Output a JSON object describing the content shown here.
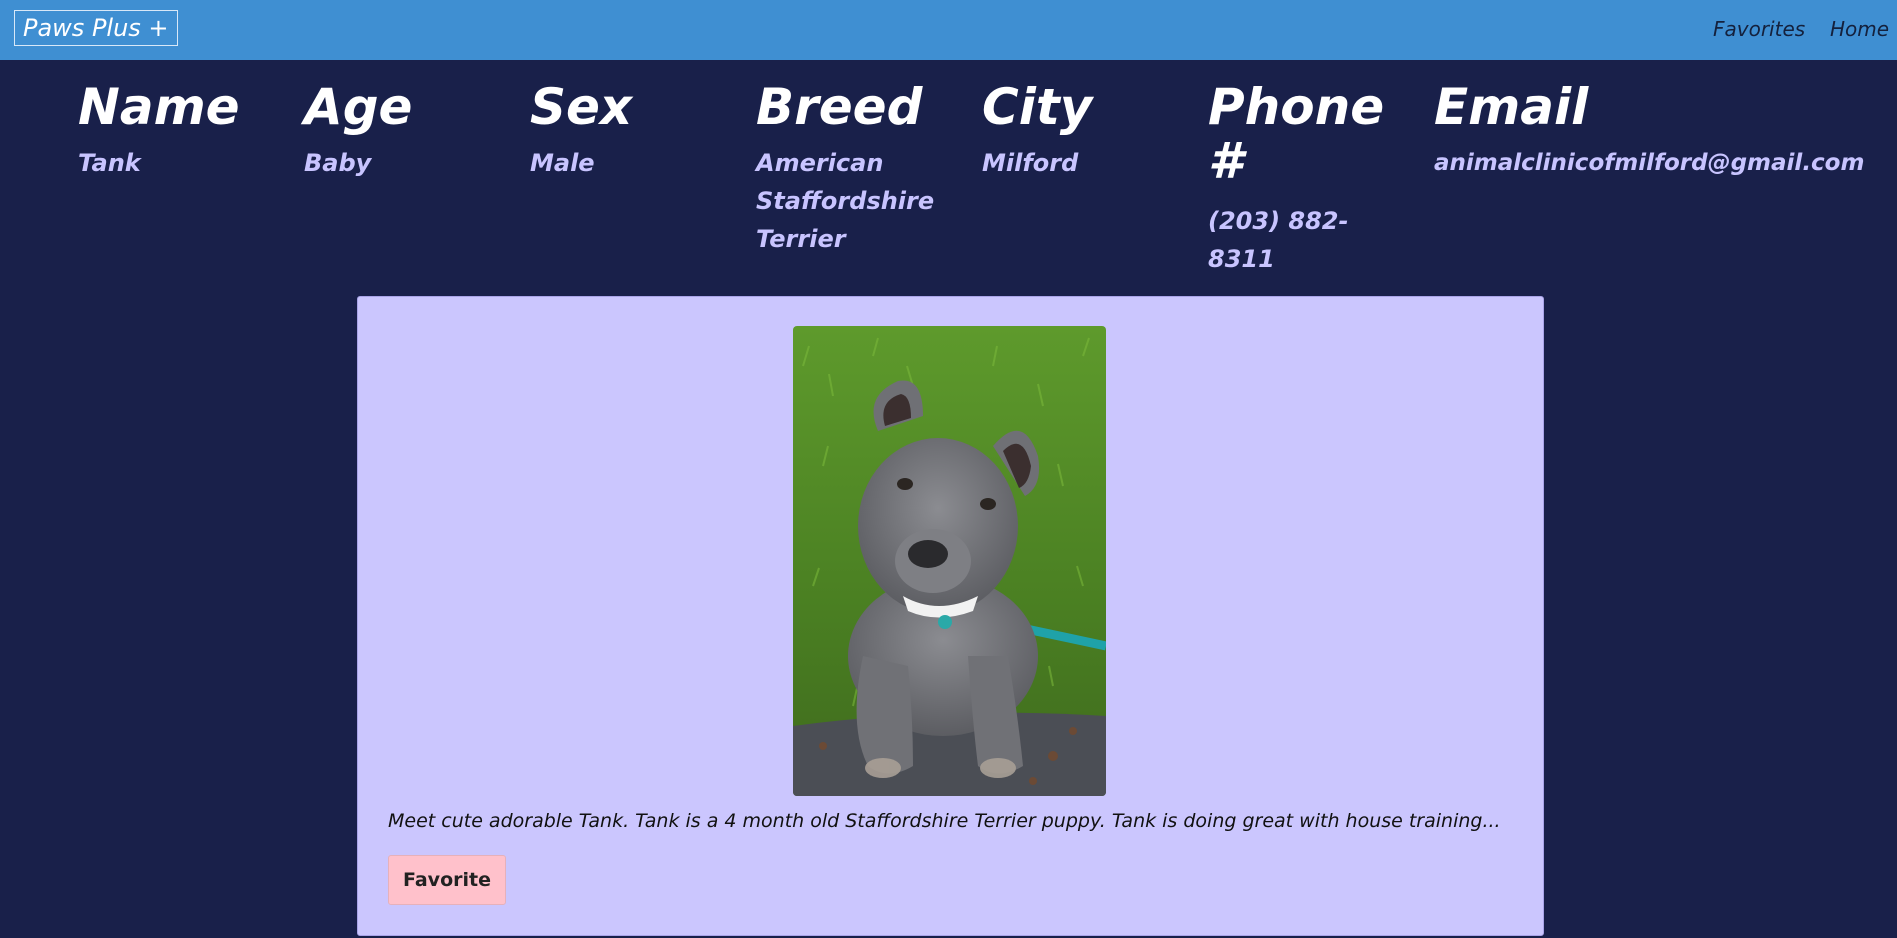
{
  "navbar": {
    "brand": "Paws Plus +",
    "links": [
      "Favorites",
      "Home"
    ]
  },
  "pet": {
    "columns": [
      {
        "header": "Name",
        "value": "Tank"
      },
      {
        "header": "Age",
        "value": "Baby"
      },
      {
        "header": "Sex",
        "value": "Male"
      },
      {
        "header": "Breed",
        "value": "American Staffordshire Terrier"
      },
      {
        "header": "City",
        "value": "Milford"
      },
      {
        "header": "Phone #",
        "value": "(203) 882-8311"
      },
      {
        "header": "Email",
        "value": "animalclinicofmilford@gmail.com"
      }
    ]
  },
  "card": {
    "description": "Meet cute adorable Tank. Tank is a 4 month old Staffordshire Terrier puppy. Tank is doing great with house training...",
    "favorite_label": "Favorite"
  }
}
